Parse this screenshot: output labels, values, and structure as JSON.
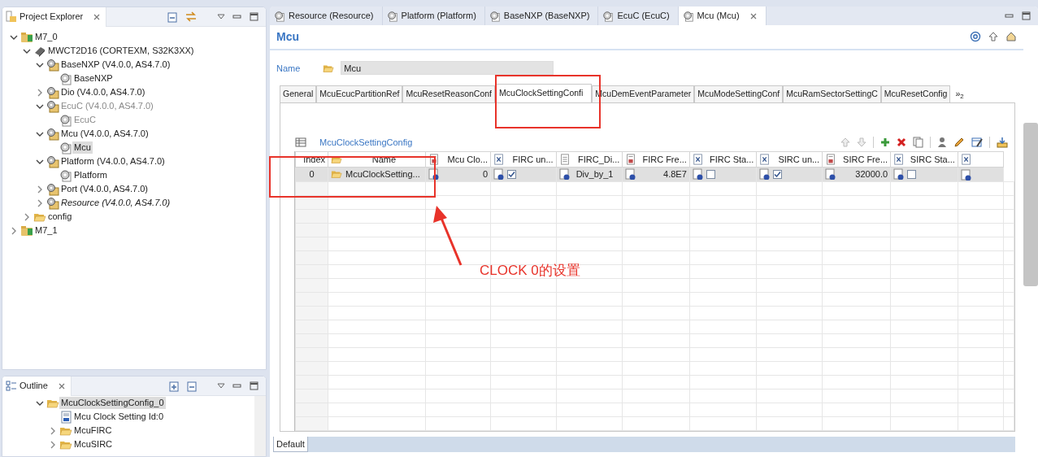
{
  "project_explorer": {
    "title": "Project Explorer",
    "tree": [
      {
        "label": "M7_0",
        "kind": "project",
        "expanded": true,
        "selected": false,
        "disabled": false,
        "italic": false,
        "children": [
          {
            "label": "MWCT2D16 (CORTEXM, S32K3XX)",
            "kind": "chip",
            "expanded": true,
            "selected": false,
            "disabled": false,
            "italic": false,
            "children": [
              {
                "label": "BaseNXP (V4.0.0, AS4.7.0)",
                "kind": "module",
                "expanded": true,
                "selected": false,
                "disabled": false,
                "italic": false,
                "children": [
                  {
                    "label": "BaseNXP",
                    "kind": "config",
                    "selected": false,
                    "disabled": false,
                    "italic": false
                  }
                ]
              },
              {
                "label": "Dio (V4.0.0, AS4.7.0)",
                "kind": "module",
                "expanded": false,
                "selected": false,
                "disabled": false,
                "italic": false
              },
              {
                "label": "EcuC (V4.0.0, AS4.7.0)",
                "kind": "module",
                "expanded": true,
                "selected": false,
                "disabled": true,
                "italic": false,
                "children": [
                  {
                    "label": "EcuC",
                    "kind": "config",
                    "selected": false,
                    "disabled": true,
                    "italic": false
                  }
                ]
              },
              {
                "label": "Mcu (V4.0.0, AS4.7.0)",
                "kind": "module",
                "expanded": true,
                "selected": false,
                "disabled": false,
                "italic": false,
                "children": [
                  {
                    "label": "Mcu",
                    "kind": "config",
                    "selected": true,
                    "disabled": false,
                    "italic": false
                  }
                ]
              },
              {
                "label": "Platform (V4.0.0, AS4.7.0)",
                "kind": "module",
                "expanded": true,
                "selected": false,
                "disabled": false,
                "italic": false,
                "children": [
                  {
                    "label": "Platform",
                    "kind": "config",
                    "selected": false,
                    "disabled": false,
                    "italic": false
                  }
                ]
              },
              {
                "label": "Port (V4.0.0, AS4.7.0)",
                "kind": "module",
                "expanded": false,
                "selected": false,
                "disabled": false,
                "italic": false
              },
              {
                "label": "Resource (V4.0.0, AS4.7.0)",
                "kind": "module",
                "expanded": false,
                "selected": false,
                "disabled": false,
                "italic": true
              }
            ]
          },
          {
            "label": "config",
            "kind": "folder",
            "expanded": false,
            "selected": false,
            "disabled": false,
            "italic": false
          }
        ]
      },
      {
        "label": "M7_1",
        "kind": "project",
        "expanded": false,
        "selected": false,
        "disabled": false,
        "italic": false
      }
    ]
  },
  "outline": {
    "title": "Outline",
    "tree": [
      {
        "label": "McuClockSettingConfig_0",
        "kind": "folder",
        "expanded": true,
        "selected": true,
        "disabled": false,
        "italic": false,
        "children": [
          {
            "label": "Mcu Clock Setting Id:0",
            "kind": "param",
            "selected": false,
            "disabled": false,
            "italic": false
          },
          {
            "label": "McuFIRC",
            "kind": "folder",
            "expanded": false,
            "selected": false,
            "disabled": false,
            "italic": false
          },
          {
            "label": "McuSIRC",
            "kind": "folder",
            "expanded": false,
            "selected": false,
            "disabled": false,
            "italic": false
          }
        ]
      }
    ]
  },
  "editor_tabs": [
    {
      "label": "Resource (Resource)",
      "selected": false
    },
    {
      "label": "Platform (Platform)",
      "selected": false
    },
    {
      "label": "BaseNXP (BaseNXP)",
      "selected": false
    },
    {
      "label": "EcuC (EcuC)",
      "selected": false
    },
    {
      "label": "Mcu (Mcu)",
      "selected": true
    }
  ],
  "editor": {
    "title": "Mcu",
    "name_label": "Name",
    "name_value": "Mcu",
    "tabs": [
      {
        "label": "General",
        "selected": false
      },
      {
        "label": "McuEcucPartitionRef",
        "selected": false
      },
      {
        "label": "McuResetReasonConf",
        "selected": false
      },
      {
        "label": "McuClockSettingConfi",
        "selected": true
      },
      {
        "label": "McuDemEventParameter",
        "selected": false
      },
      {
        "label": "McuModeSettingConf",
        "selected": false
      },
      {
        "label": "McuRamSectorSettingC",
        "selected": false
      },
      {
        "label": "McuResetConfig",
        "selected": false
      }
    ],
    "tabs_overflow": "»$_{2}$",
    "section_title": "McuClockSettingConfig",
    "columns": [
      {
        "label": "Index",
        "kind": "plain"
      },
      {
        "label": "Name",
        "kind": "folder"
      },
      {
        "label": "Mcu Clo...",
        "kind": "number"
      },
      {
        "label": "FIRC un...",
        "kind": "boolean"
      },
      {
        "label": "FIRC_Di...",
        "kind": "text"
      },
      {
        "label": "FIRC Fre...",
        "kind": "number"
      },
      {
        "label": "FIRC Sta...",
        "kind": "boolean"
      },
      {
        "label": "SIRC un...",
        "kind": "boolean"
      },
      {
        "label": "SIRC Fre...",
        "kind": "number"
      },
      {
        "label": "SIRC Sta...",
        "kind": "boolean"
      },
      {
        "kind": "boolean"
      }
    ],
    "rows": [
      {
        "selected": true,
        "cells": [
          {
            "kind": "index",
            "text": "0"
          },
          {
            "kind": "folder",
            "text": "McuClockSetting..."
          },
          {
            "kind": "number",
            "text": "0"
          },
          {
            "kind": "boolean",
            "checked": true
          },
          {
            "kind": "text",
            "text": "Div_by_1"
          },
          {
            "kind": "number",
            "text": "4.8E7"
          },
          {
            "kind": "boolean",
            "checked": false
          },
          {
            "kind": "boolean",
            "checked": true
          },
          {
            "kind": "number",
            "text": "32000.0"
          },
          {
            "kind": "boolean",
            "checked": false
          },
          {
            "kind": "marker"
          }
        ]
      }
    ],
    "bottom_tab": "Default"
  },
  "annotation": {
    "text": "CLOCK 0的设置"
  }
}
